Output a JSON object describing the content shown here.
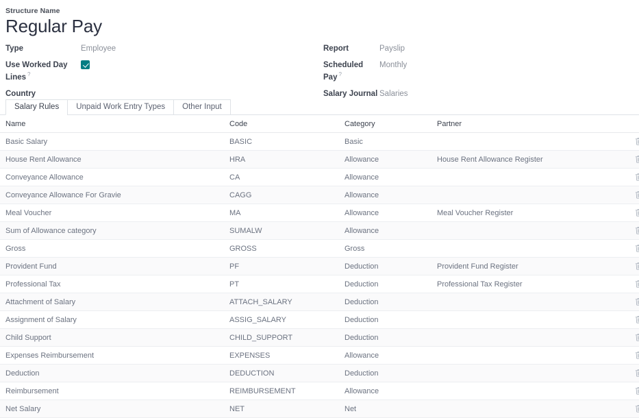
{
  "header": {
    "structure_name_label": "Structure Name",
    "title": "Regular Pay"
  },
  "form": {
    "left_fields": [
      {
        "label": "Type",
        "value": "Employee",
        "type": "text",
        "help": false
      },
      {
        "label": "Use Worked Day Lines",
        "value": "",
        "type": "checkbox",
        "checked": true,
        "help": true,
        "help_marker": "?"
      },
      {
        "label": "Country",
        "value": "",
        "type": "text",
        "help": false
      }
    ],
    "right_fields": [
      {
        "label": "Report",
        "value": "Payslip",
        "type": "text",
        "help": false
      },
      {
        "label": "Scheduled Pay",
        "value": "Monthly",
        "type": "text",
        "help": true,
        "help_marker": "?"
      },
      {
        "label": "Salary Journal",
        "value": "Salaries",
        "type": "text",
        "help": false
      }
    ]
  },
  "tabs": [
    {
      "label": "Salary Rules",
      "active": true
    },
    {
      "label": "Unpaid Work Entry Types",
      "active": false
    },
    {
      "label": "Other Input",
      "active": false
    }
  ],
  "table": {
    "columns": [
      "Name",
      "Code",
      "Category",
      "Partner"
    ],
    "delete_icon": "trash-icon",
    "rows": [
      {
        "name": "Basic Salary",
        "code": "BASIC",
        "category": "Basic",
        "partner": ""
      },
      {
        "name": "House Rent Allowance",
        "code": "HRA",
        "category": "Allowance",
        "partner": "House Rent Allowance Register"
      },
      {
        "name": "Conveyance Allowance",
        "code": "CA",
        "category": "Allowance",
        "partner": ""
      },
      {
        "name": "Conveyance Allowance For Gravie",
        "code": "CAGG",
        "category": "Allowance",
        "partner": ""
      },
      {
        "name": "Meal Voucher",
        "code": "MA",
        "category": "Allowance",
        "partner": "Meal Voucher Register"
      },
      {
        "name": "Sum of Allowance category",
        "code": "SUMALW",
        "category": "Allowance",
        "partner": ""
      },
      {
        "name": "Gross",
        "code": "GROSS",
        "category": "Gross",
        "partner": ""
      },
      {
        "name": "Provident Fund",
        "code": "PF",
        "category": "Deduction",
        "partner": "Provident Fund Register"
      },
      {
        "name": "Professional Tax",
        "code": "PT",
        "category": "Deduction",
        "partner": "Professional Tax Register"
      },
      {
        "name": "Attachment of Salary",
        "code": "ATTACH_SALARY",
        "category": "Deduction",
        "partner": ""
      },
      {
        "name": "Assignment of Salary",
        "code": "ASSIG_SALARY",
        "category": "Deduction",
        "partner": ""
      },
      {
        "name": "Child Support",
        "code": "CHILD_SUPPORT",
        "category": "Deduction",
        "partner": ""
      },
      {
        "name": "Expenses Reimbursement",
        "code": "EXPENSES",
        "category": "Allowance",
        "partner": ""
      },
      {
        "name": "Deduction",
        "code": "DEDUCTION",
        "category": "Deduction",
        "partner": ""
      },
      {
        "name": "Reimbursement",
        "code": "REIMBURSEMENT",
        "category": "Allowance",
        "partner": ""
      },
      {
        "name": "Net Salary",
        "code": "NET",
        "category": "Net",
        "partner": ""
      }
    ]
  },
  "colors": {
    "accent": "#017e84",
    "title": "#2b3040",
    "label": "#3c424e",
    "value": "#8a8f99",
    "border": "#dee2e6"
  }
}
